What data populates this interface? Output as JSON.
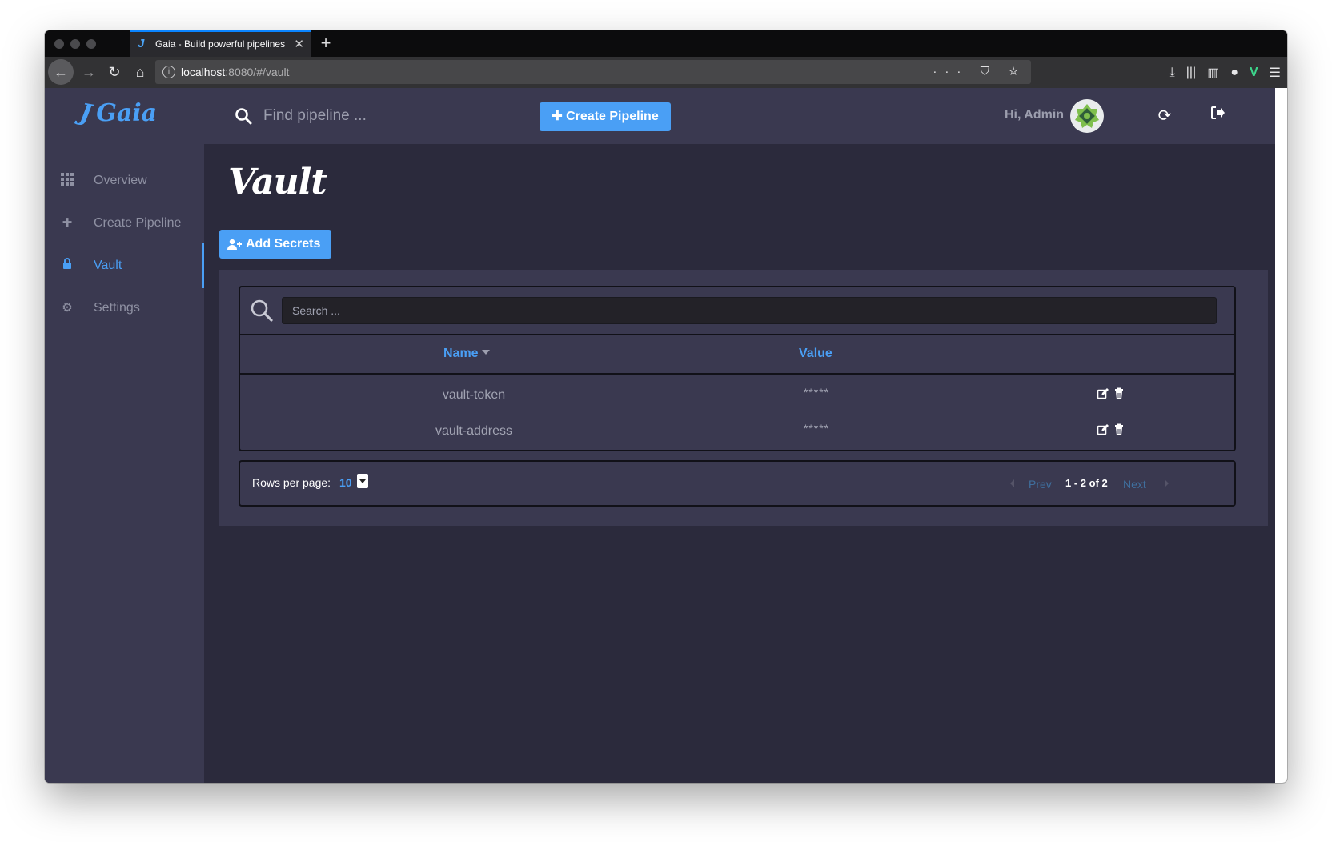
{
  "browser": {
    "tab_title": "Gaia - Build powerful pipelines",
    "tab_close": "✕",
    "new_tab": "+",
    "url_host": "localhost",
    "url_rest": ":8080/#/vault",
    "url_actions": "··· ⛉ ☆"
  },
  "app": {
    "logo_text": "Gaia",
    "sidebar": {
      "items": [
        {
          "label": "Overview",
          "icon": "grid-icon"
        },
        {
          "label": "Create Pipeline",
          "icon": "plus-icon"
        },
        {
          "label": "Vault",
          "icon": "lock-icon",
          "active": true
        },
        {
          "label": "Settings",
          "icon": "gears-icon"
        }
      ]
    },
    "topbar": {
      "search_placeholder": "Find pipeline ...",
      "create_button": "Create Pipeline",
      "greeting": "Hi, Admin"
    },
    "page": {
      "title": "Vault",
      "add_button": "Add Secrets"
    },
    "table": {
      "search_placeholder": "Search ...",
      "columns": [
        "Name",
        "Value"
      ],
      "rows": [
        {
          "name": "vault-token",
          "value": "*****"
        },
        {
          "name": "vault-address",
          "value": "*****"
        }
      ]
    },
    "pagination": {
      "rows_per_page_label": "Rows per page:",
      "rows_per_page": "10",
      "prev": "Prev",
      "info": "1 - 2 of 2",
      "next": "Next"
    }
  },
  "colors": {
    "accent": "#4a9ff5",
    "sidebar_bg": "#3a3950",
    "content_bg": "#2b2a3c"
  }
}
